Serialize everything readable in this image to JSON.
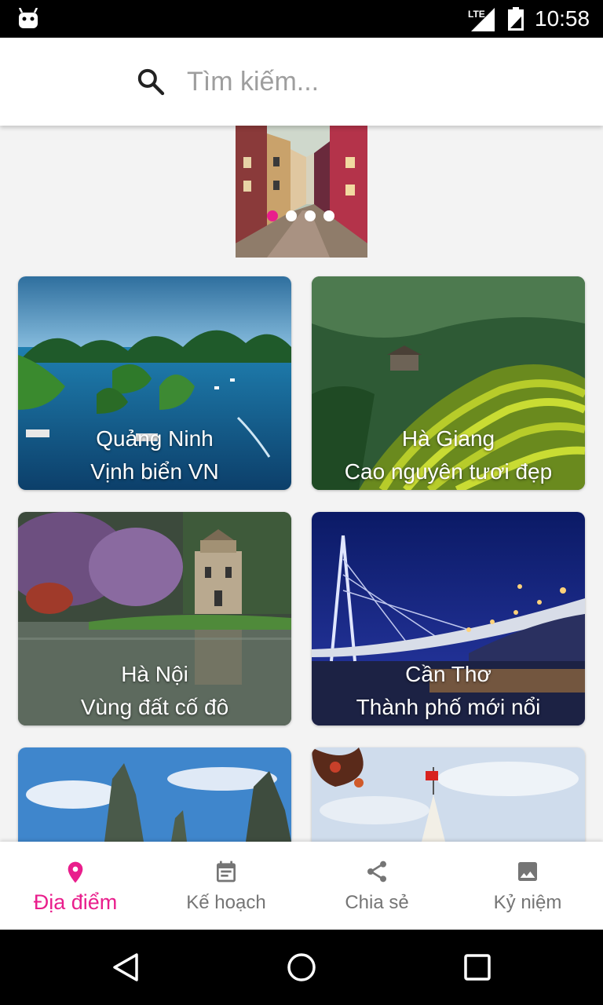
{
  "status_bar": {
    "time": "10:58",
    "network": "LTE"
  },
  "search": {
    "placeholder": "Tìm kiếm..."
  },
  "banner": {
    "dots": 4,
    "active_dot": 0
  },
  "places": [
    {
      "name": "Quảng Ninh",
      "subtitle": "Vịnh biển VN"
    },
    {
      "name": "Hà Giang",
      "subtitle": "Cao nguyên tươi đẹp"
    },
    {
      "name": "Hà Nội",
      "subtitle": "Vùng đất cố đô"
    },
    {
      "name": "Cần Thơ",
      "subtitle": "Thành phố mới nổi"
    }
  ],
  "nav": {
    "items": [
      {
        "label": "Địa điểm",
        "icon": "location-pin-icon",
        "active": true
      },
      {
        "label": "Kế hoạch",
        "icon": "calendar-icon",
        "active": false
      },
      {
        "label": "Chia sẻ",
        "icon": "share-icon",
        "active": false
      },
      {
        "label": "Kỷ niệm",
        "icon": "image-icon",
        "active": false
      }
    ]
  },
  "colors": {
    "accent": "#e91e8c",
    "inactive": "#757575",
    "background": "#f3f3f3"
  }
}
